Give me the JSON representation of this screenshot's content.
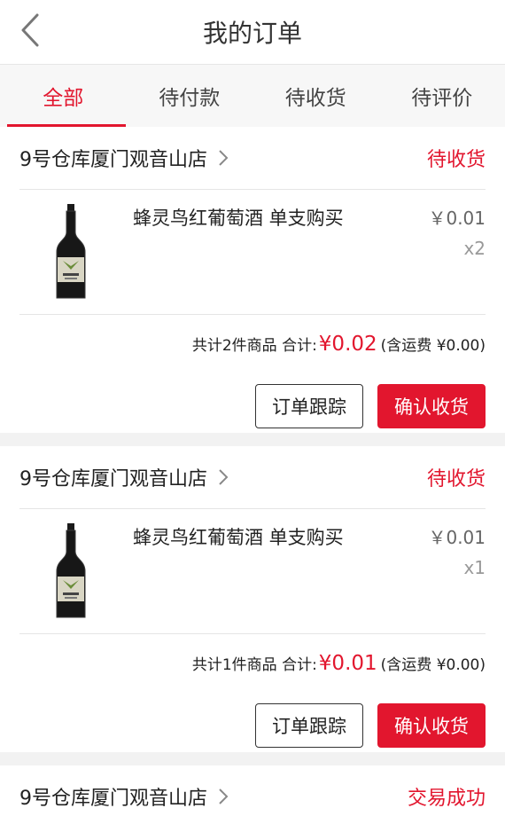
{
  "header": {
    "title": "我的订单"
  },
  "tabs": [
    {
      "label": "全部",
      "active": true
    },
    {
      "label": "待付款",
      "active": false
    },
    {
      "label": "待收货",
      "active": false
    },
    {
      "label": "待评价",
      "active": false
    }
  ],
  "orders": [
    {
      "store": "9号仓库厦门观音山店",
      "status": "待收货",
      "item": {
        "name": "蜂灵鸟红葡萄酒 单支购买",
        "price": "￥0.01",
        "qty": "x2",
        "image": "wine-bottle"
      },
      "summary": {
        "count_text": "共计2件商品 合计:",
        "total": "¥0.02",
        "shipping": "(含运费 ¥0.00)"
      },
      "buttons": {
        "track": "订单跟踪",
        "confirm": "确认收货"
      }
    },
    {
      "store": "9号仓库厦门观音山店",
      "status": "待收货",
      "item": {
        "name": "蜂灵鸟红葡萄酒 单支购买",
        "price": "￥0.01",
        "qty": "x1",
        "image": "wine-bottle"
      },
      "summary": {
        "count_text": "共计1件商品 合计:",
        "total": "¥0.01",
        "shipping": "(含运费 ¥0.00)"
      },
      "buttons": {
        "track": "订单跟踪",
        "confirm": "确认收货"
      }
    },
    {
      "store": "9号仓库厦门观音山店",
      "status": "交易成功"
    }
  ],
  "colors": {
    "accent": "#e2162e",
    "background": "#f2f2f2",
    "text": "#222222"
  },
  "icons": {
    "back": "chevron-left-icon",
    "store_arrow": "chevron-right-icon"
  }
}
